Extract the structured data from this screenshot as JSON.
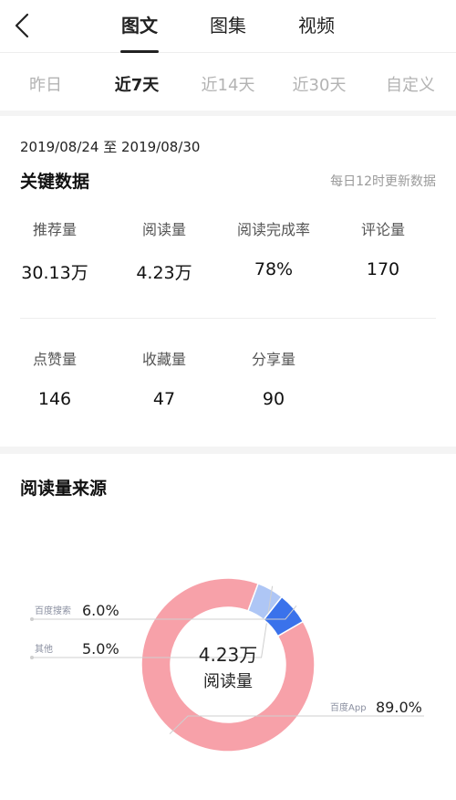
{
  "nav": {
    "tabs": [
      {
        "label": "图文",
        "active": true
      },
      {
        "label": "图集",
        "active": false
      },
      {
        "label": "视频",
        "active": false
      }
    ]
  },
  "periods": [
    {
      "label": "昨日",
      "active": false
    },
    {
      "label": "近7天",
      "active": true
    },
    {
      "label": "近14天",
      "active": false
    },
    {
      "label": "近30天",
      "active": false
    },
    {
      "label": "自定义",
      "active": false
    }
  ],
  "key_data": {
    "date_range": "2019/08/24 至 2019/08/30",
    "title": "关键数据",
    "update_note": "每日12时更新数据",
    "row1": [
      {
        "label": "推荐量",
        "value": "30.13万"
      },
      {
        "label": "阅读量",
        "value": "4.23万"
      },
      {
        "label": "阅读完成率",
        "value": "78%"
      },
      {
        "label": "评论量",
        "value": "170"
      }
    ],
    "row2": [
      {
        "label": "点赞量",
        "value": "146"
      },
      {
        "label": "收藏量",
        "value": "47"
      },
      {
        "label": "分享量",
        "value": "90"
      }
    ]
  },
  "source": {
    "title": "阅读量来源",
    "center_value": "4.23万",
    "center_label": "阅读量"
  },
  "chart_data": {
    "type": "pie",
    "center_value": "4.23万",
    "center_label": "阅读量",
    "slices": [
      {
        "name": "百度App",
        "percent": 89.0,
        "display": "89.0%",
        "color": "#f7a1a9"
      },
      {
        "name": "其他",
        "percent": 5.0,
        "display": "5.0%",
        "color": "#aec6f5"
      },
      {
        "name": "百度搜索",
        "percent": 6.0,
        "display": "6.0%",
        "color": "#3a72eb"
      }
    ]
  }
}
